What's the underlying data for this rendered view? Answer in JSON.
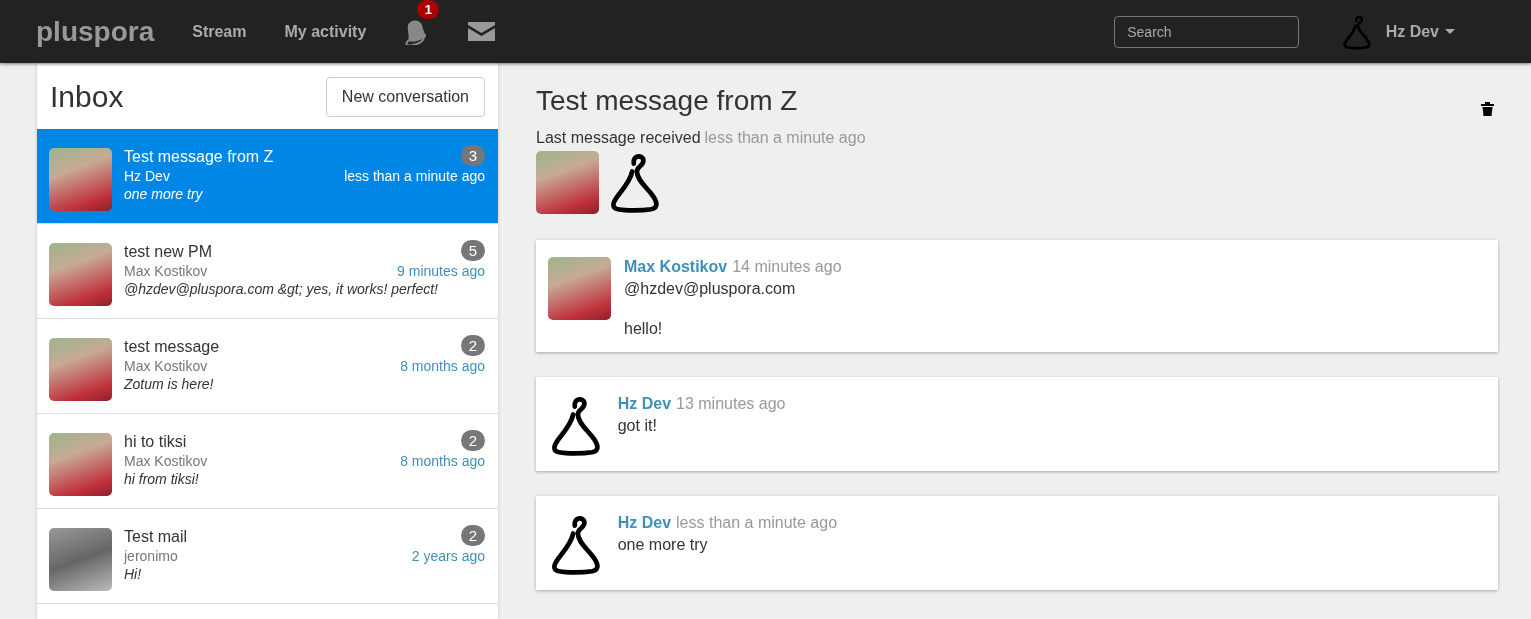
{
  "navbar": {
    "brand": "pluspora",
    "links": [
      "Stream",
      "My activity"
    ],
    "notification_count": "1",
    "search": {
      "placeholder": "Search"
    },
    "user": {
      "name": "Hz Dev",
      "avatar": {
        "kind": "bell"
      }
    }
  },
  "inbox": {
    "title": "Inbox",
    "new_button": "New conversation",
    "conversations": [
      {
        "subject": "Test message from Z",
        "author": "Hz Dev",
        "preview": "one more try",
        "count": "3",
        "time": "less than a minute ago",
        "selected": true,
        "avatar": {
          "kind": "photo"
        }
      },
      {
        "subject": "test new PM",
        "author": "Max Kostikov",
        "preview": "@hzdev@pluspora.com &gt; yes, it works! perfect!",
        "count": "5",
        "time": "9 minutes ago",
        "selected": false,
        "avatar": {
          "kind": "photo"
        }
      },
      {
        "subject": "test message",
        "author": "Max Kostikov",
        "preview": "Zotum is here!",
        "count": "2",
        "time": "8 months ago",
        "selected": false,
        "avatar": {
          "kind": "photo"
        }
      },
      {
        "subject": "hi to tiksi",
        "author": "Max Kostikov",
        "preview": "hi from tiksi!",
        "count": "2",
        "time": "8 months ago",
        "selected": false,
        "avatar": {
          "kind": "photo"
        }
      },
      {
        "subject": "Test mail",
        "author": "jeronimo",
        "preview": "Hi!",
        "count": "2",
        "time": "2 years ago",
        "selected": false,
        "avatar": {
          "kind": "photo_bw"
        }
      }
    ]
  },
  "conversation": {
    "title": "Test message from Z",
    "last_label": "Last message received",
    "last_time": "less than a minute ago",
    "participants": [
      {
        "kind": "photo"
      },
      {
        "kind": "bell"
      }
    ],
    "messages": [
      {
        "author": "Max Kostikov",
        "time": "14 minutes ago",
        "avatar": {
          "kind": "photo"
        },
        "paragraphs": [
          "@hzdev@pluspora.com",
          "hello!"
        ]
      },
      {
        "author": "Hz Dev",
        "time": "13 minutes ago",
        "avatar": {
          "kind": "bell"
        },
        "paragraphs": [
          "got it!"
        ]
      },
      {
        "author": "Hz Dev",
        "time": "less than a minute ago",
        "avatar": {
          "kind": "bell"
        },
        "paragraphs": [
          "one more try"
        ]
      }
    ]
  }
}
